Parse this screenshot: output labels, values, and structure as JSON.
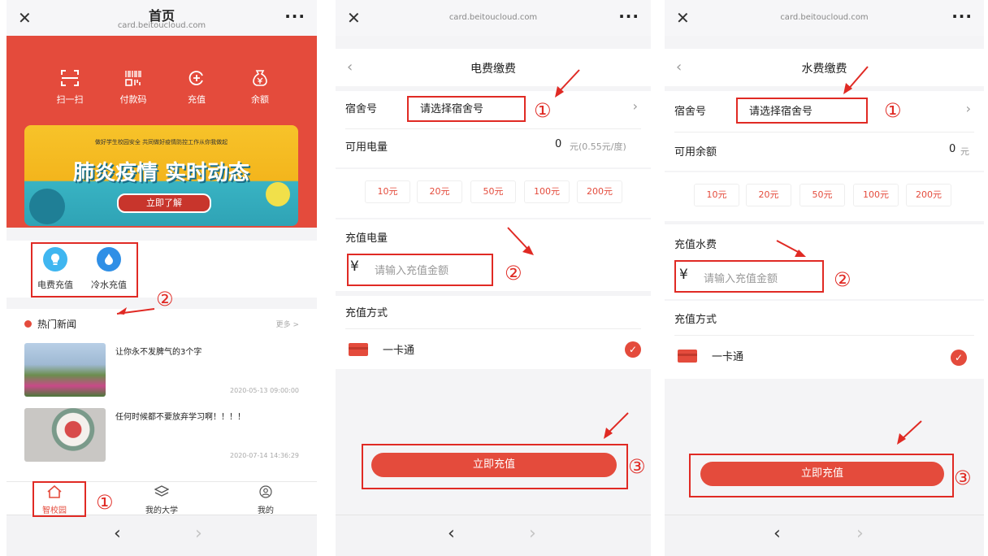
{
  "home": {
    "title": "首页",
    "url": "card.beitoucloud.com",
    "quick_actions": [
      {
        "icon": "scan-icon",
        "label": "扫一扫"
      },
      {
        "icon": "barcode-icon",
        "label": "付款码"
      },
      {
        "icon": "recharge-icon",
        "label": "充值"
      },
      {
        "icon": "money-bag-icon",
        "label": "余额"
      }
    ],
    "banner": {
      "small_text": "做好学生校园安全 共同做好疫情防控工作从你我做起",
      "big_text": "肺炎疫情 实时动态",
      "button": "立即了解"
    },
    "services": [
      {
        "icon": "bulb-icon",
        "label": "电费充值",
        "color": "#3fb6f0"
      },
      {
        "icon": "water-drop-icon",
        "label": "冷水充值",
        "color": "#2f8fe6"
      }
    ],
    "news_header": "热门新闻",
    "news_more": "更多 >",
    "news": [
      {
        "title": "让你永不发脾气的3个字",
        "date": "2020-05-13 09:00:00"
      },
      {
        "title": "任何时候都不要放弃学习啊！！！！",
        "date": "2020-07-14 14:36:29"
      }
    ],
    "tabs": [
      {
        "icon": "home-icon",
        "label": "智校园"
      },
      {
        "icon": "layers-icon",
        "label": "我的大学"
      },
      {
        "icon": "user-icon",
        "label": "我的"
      }
    ]
  },
  "electric": {
    "url": "card.beitoucloud.com",
    "title": "电费缴费",
    "room_label": "宿舍号",
    "room_placeholder": "请选择宿舍号",
    "balance_label": "可用电量",
    "balance_value": "0",
    "balance_unit": "元(0.55元/度)",
    "amounts": [
      "10元",
      "20元",
      "50元",
      "100元",
      "200元"
    ],
    "input_label": "充值电量",
    "currency": "¥",
    "input_placeholder": "请输入充值金额",
    "method_label": "充值方式",
    "method": "一卡通",
    "submit": "立即充值"
  },
  "water": {
    "url": "card.beitoucloud.com",
    "title": "水费缴费",
    "room_label": "宿舍号",
    "room_placeholder": "请选择宿舍号",
    "balance_label": "可用余额",
    "balance_value": "0",
    "balance_unit": "元",
    "amounts": [
      "10元",
      "20元",
      "50元",
      "100元",
      "200元"
    ],
    "input_label": "充值水费",
    "currency": "¥",
    "input_placeholder": "请输入充值金额",
    "method_label": "充值方式",
    "method": "一卡通",
    "submit": "立即充值"
  },
  "annotations": {
    "step1": "①",
    "step2": "②",
    "step3": "③"
  },
  "colors": {
    "brand_red": "#e44b3c",
    "annotation_red": "#e02a24"
  }
}
